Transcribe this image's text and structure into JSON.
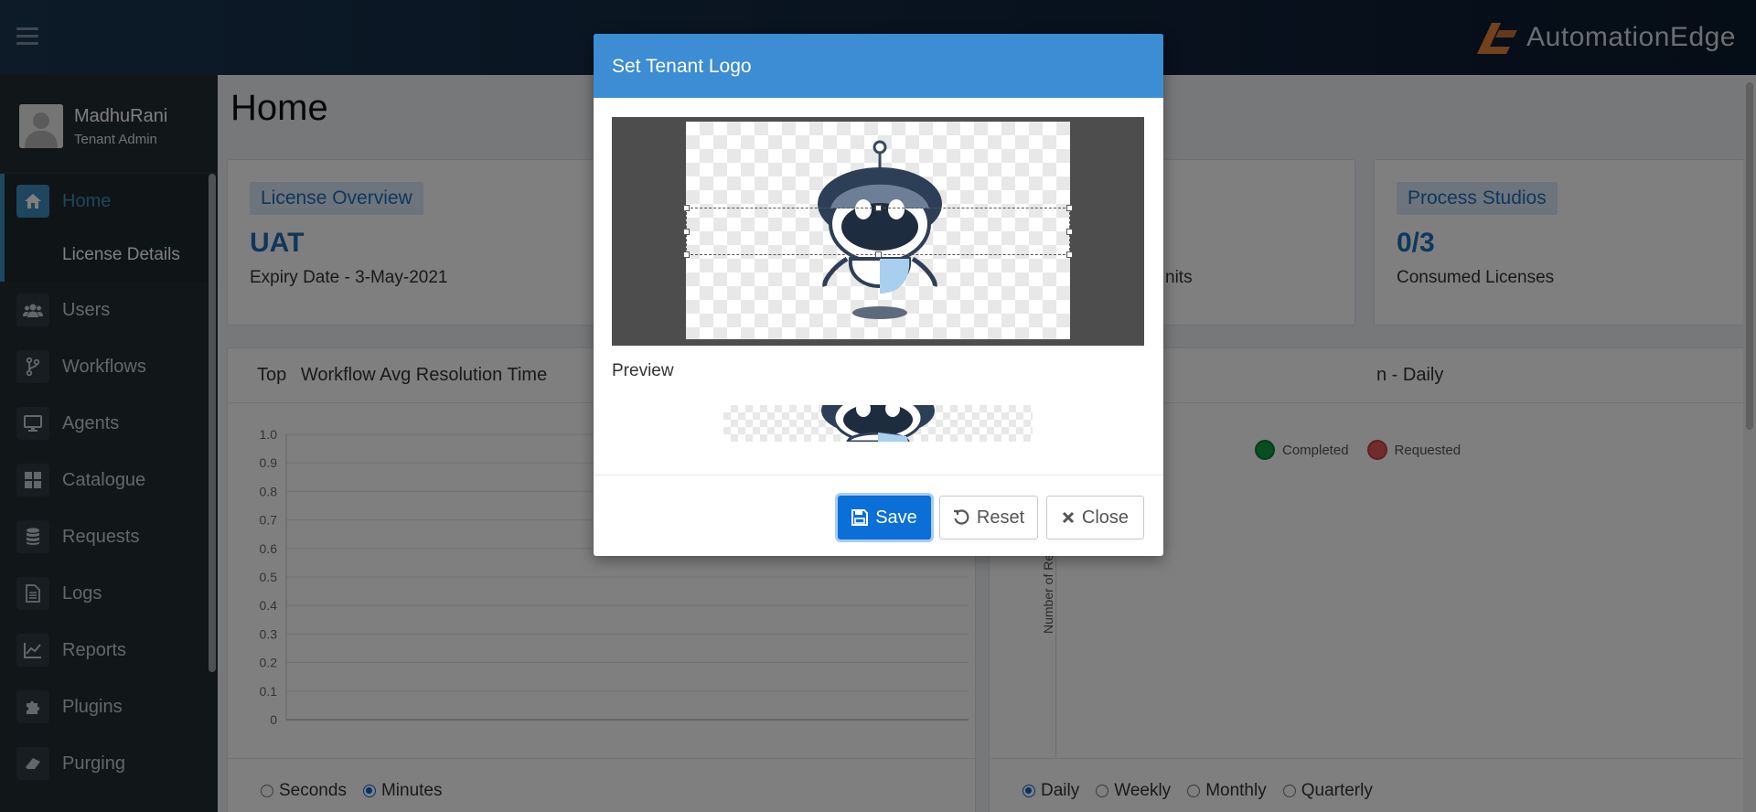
{
  "header": {
    "brand": "AutomationEdge"
  },
  "user": {
    "name": "MadhuRani",
    "role": "Tenant Admin"
  },
  "sidebar": {
    "items": [
      {
        "label": "Home",
        "icon": "home-icon",
        "active": true
      },
      {
        "label": "License Details",
        "sub": true
      },
      {
        "label": "Users",
        "icon": "users-icon"
      },
      {
        "label": "Workflows",
        "icon": "workflow-icon"
      },
      {
        "label": "Agents",
        "icon": "monitor-icon"
      },
      {
        "label": "Catalogue",
        "icon": "grid-icon"
      },
      {
        "label": "Requests",
        "icon": "database-icon"
      },
      {
        "label": "Logs",
        "icon": "file-icon"
      },
      {
        "label": "Reports",
        "icon": "chart-line-icon"
      },
      {
        "label": "Plugins",
        "icon": "puzzle-icon"
      },
      {
        "label": "Purging",
        "icon": "eraser-icon"
      }
    ]
  },
  "page": {
    "title": "Home"
  },
  "cards": {
    "license": {
      "badge": "License Overview",
      "value": "UAT",
      "sub": "Expiry Date - 3-May-2021"
    },
    "middle_sub_fragment": "nits",
    "studios": {
      "badge": "Process Studios",
      "value": "0/3",
      "sub": "Consumed Licenses"
    }
  },
  "left_panel": {
    "title_prefix": "Top",
    "title": "Workflow Avg Resolution Time",
    "radios": [
      {
        "label": "Seconds",
        "checked": false
      },
      {
        "label": "Minutes",
        "checked": true
      }
    ]
  },
  "right_panel": {
    "title_fragment": "n - Daily",
    "legend": [
      {
        "label": "Completed",
        "color": "#00a65a"
      },
      {
        "label": "Requested",
        "color": "#dd4b39"
      }
    ],
    "ylabel_fragment": "Number of Requ",
    "radios": [
      {
        "label": "Daily",
        "checked": true
      },
      {
        "label": "Weekly",
        "checked": false
      },
      {
        "label": "Monthly",
        "checked": false
      },
      {
        "label": "Quarterly",
        "checked": false
      }
    ]
  },
  "chart_data": {
    "type": "bar",
    "title": "Workflow Avg Resolution Time",
    "categories": [],
    "values": [],
    "ylim": [
      0,
      1.0
    ],
    "yticks": [
      "1.0",
      "0.9",
      "0.8",
      "0.7",
      "0.6",
      "0.5",
      "0.4",
      "0.3",
      "0.2",
      "0.1",
      "0"
    ],
    "grid": true
  },
  "modal": {
    "title": "Set Tenant Logo",
    "preview_label": "Preview",
    "buttons": {
      "save": "Save",
      "reset": "Reset",
      "close": "Close"
    }
  }
}
